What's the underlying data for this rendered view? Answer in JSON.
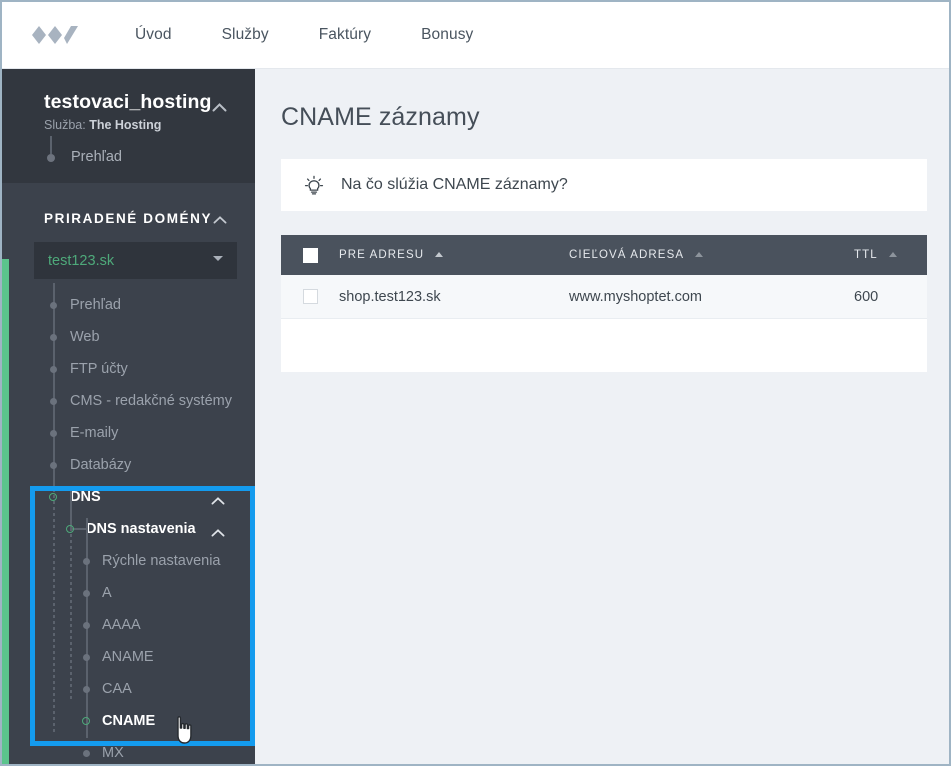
{
  "colors": {
    "accent_green": "#5bc48c",
    "highlight_blue": "#149bee",
    "sidebar_bg": "#3c424c",
    "service_bg": "#32373f",
    "table_header": "#4a525d",
    "page_bg": "#eef1f5"
  },
  "topnav": {
    "logo_name": "brand-logo",
    "items": [
      {
        "label": "Úvod"
      },
      {
        "label": "Služby"
      },
      {
        "label": "Faktúry"
      },
      {
        "label": "Bonusy"
      }
    ]
  },
  "sidebar": {
    "service": {
      "title": "testovaci_hosting",
      "sub_label": "Služba:",
      "sub_value": "The Hosting",
      "collapse_icon": "chevron-up-icon",
      "link": "Prehľad"
    },
    "domains_section": {
      "heading": "PRIRADENÉ DOMÉNY",
      "collapse_icon": "chevron-up-icon",
      "select_value": "test123.sk",
      "select_caret_icon": "chevron-down-icon"
    },
    "tree": [
      {
        "label": "Prehľad",
        "level": 1,
        "marker": "solid"
      },
      {
        "label": "Web",
        "level": 1,
        "marker": "solid"
      },
      {
        "label": "FTP účty",
        "level": 1,
        "marker": "solid"
      },
      {
        "label": "CMS - redakčné systémy",
        "level": 1,
        "marker": "solid"
      },
      {
        "label": "E-maily",
        "level": 1,
        "marker": "solid"
      },
      {
        "label": "Databázy",
        "level": 1,
        "marker": "solid"
      },
      {
        "label": "DNS",
        "level": 1,
        "marker": "ring",
        "active": true,
        "collapse_icon": "chevron-up-icon"
      },
      {
        "label": "DNS nastavenia",
        "level": 2,
        "marker": "ring",
        "active": true,
        "collapse_icon": "chevron-up-icon"
      },
      {
        "label": "Rýchle nastavenia",
        "level": 3,
        "marker": "none"
      },
      {
        "label": "A",
        "level": 3,
        "marker": "solid"
      },
      {
        "label": "AAAA",
        "level": 3,
        "marker": "solid"
      },
      {
        "label": "ANAME",
        "level": 3,
        "marker": "solid"
      },
      {
        "label": "CAA",
        "level": 3,
        "marker": "solid"
      },
      {
        "label": "CNAME",
        "level": 3,
        "marker": "ring",
        "selected": true
      },
      {
        "label": "MX",
        "level": 3,
        "marker": "solid"
      }
    ]
  },
  "main": {
    "page_title": "CNAME záznamy",
    "hint": {
      "icon": "lightbulb-icon",
      "text": "Na čo slúžia CNAME záznamy?"
    },
    "table": {
      "columns": [
        {
          "label": "PRE ADRESU",
          "sort_icon": "sort-asc-icon",
          "sort_active": true
        },
        {
          "label": "CIEĽOVÁ ADRESA",
          "sort_icon": "sort-asc-icon",
          "sort_active": false
        },
        {
          "label": "TTL",
          "sort_icon": "sort-asc-icon",
          "sort_active": false
        }
      ],
      "rows": [
        {
          "pre_adresu": "shop.test123.sk",
          "cielova_adresa": "www.myshoptet.com",
          "ttl": "600"
        }
      ]
    }
  },
  "cursor": {
    "icon": "pointing-hand-cursor"
  }
}
